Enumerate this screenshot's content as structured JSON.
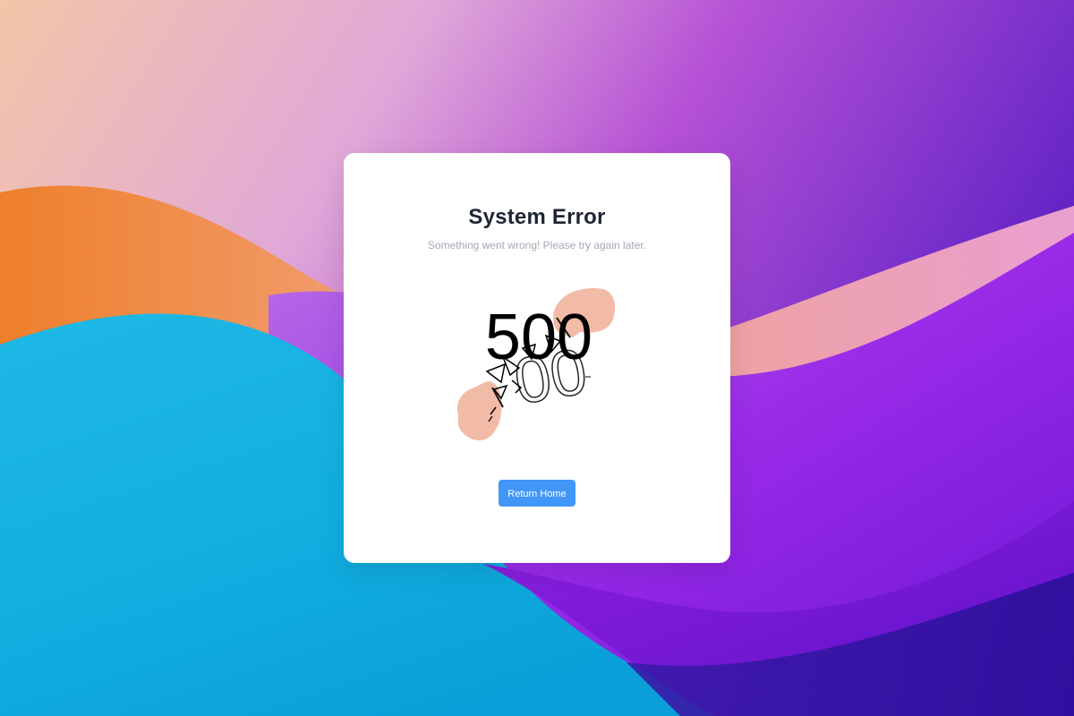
{
  "error_card": {
    "title": "System Error",
    "subtitle": "Something went wrong! Please try again later.",
    "illustration": {
      "code": "500",
      "icon": "broken-500-illustration",
      "hand_color": "#f2bba8"
    },
    "return_button_label": "Return Home"
  },
  "colors": {
    "accent": "#4296f7",
    "title": "#1f2533",
    "subtitle": "#a3a8b3",
    "card_background": "#ffffff"
  }
}
